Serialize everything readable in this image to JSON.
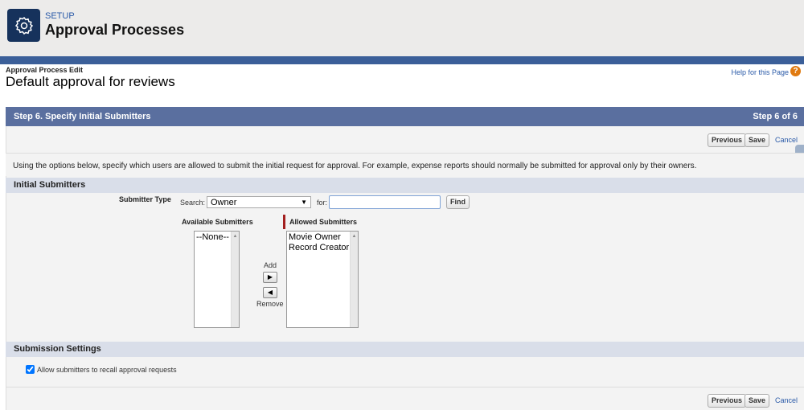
{
  "header": {
    "eyebrow": "SETUP",
    "title": "Approval Processes"
  },
  "page": {
    "breadcrumb": "Approval Process Edit",
    "title": "Default approval for reviews",
    "help_link": "Help for this Page",
    "help_icon": "?"
  },
  "step": {
    "title": "Step 6. Specify Initial Submitters",
    "counter": "Step 6 of 6"
  },
  "buttons": {
    "previous": "Previous",
    "save": "Save",
    "cancel": "Cancel"
  },
  "description": "Using the options below, specify which users are allowed to submit the initial request for approval. For example, expense reports should normally be submitted for approval only by their owners.",
  "initial_submitters": {
    "section_title": "Initial Submitters",
    "submitter_type_label": "Submitter Type",
    "search_label": "Search:",
    "search_value": "Owner",
    "for_label": "for:",
    "for_value": "",
    "find_label": "Find",
    "available_label": "Available Submitters",
    "available": [
      "--None--"
    ],
    "allowed_label": "Allowed Submitters",
    "allowed": [
      "Movie Owner",
      "Record Creator"
    ],
    "add_label": "Add",
    "remove_label": "Remove"
  },
  "submission_settings": {
    "section_title": "Submission Settings",
    "recall_label": "Allow submitters to recall approval requests",
    "recall_checked": true
  }
}
